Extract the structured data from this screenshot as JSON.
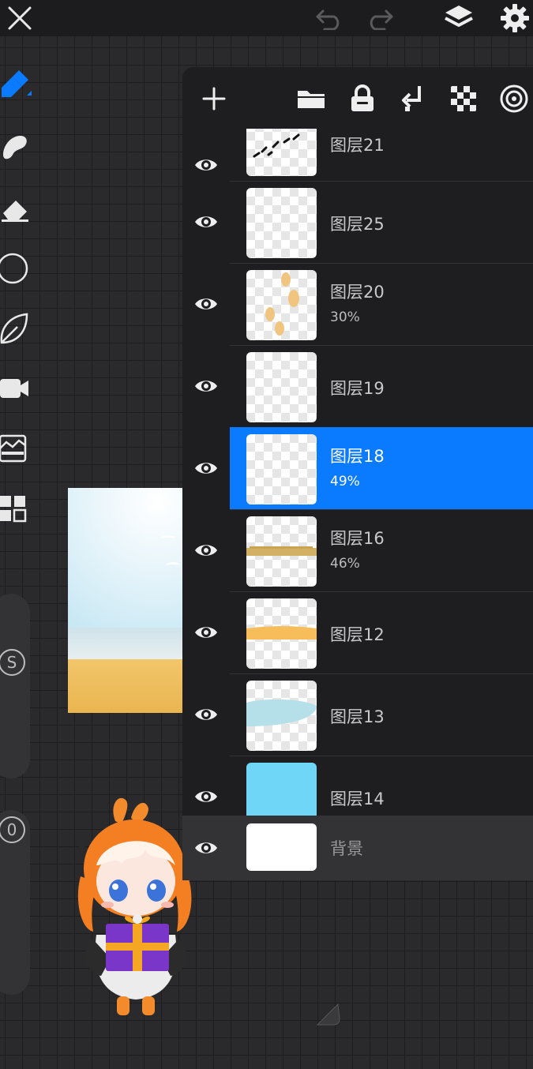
{
  "topbar": {
    "icons": [
      "close-icon",
      "undo-icon",
      "redo-icon",
      "layers-icon",
      "gear-icon"
    ]
  },
  "tools": {
    "icons": [
      "brush-icon",
      "smudge-icon",
      "eraser-icon",
      "select-circle-icon",
      "leaf-icon",
      "video-icon",
      "filter-icon",
      "gallery-grid-icon"
    ],
    "size_slider_label": "S",
    "opacity_slider_label": "0"
  },
  "layer_panel": {
    "toolbar_icons": [
      "add-icon",
      "folder-icon",
      "lock-icon",
      "merge-down-icon",
      "checker-icon",
      "target-icon"
    ],
    "layers": [
      {
        "name": "图层21",
        "opacity": "",
        "selected": false
      },
      {
        "name": "图层25",
        "opacity": "",
        "selected": false
      },
      {
        "name": "图层20",
        "opacity": "30%",
        "selected": false
      },
      {
        "name": "图层19",
        "opacity": "",
        "selected": false
      },
      {
        "name": "图层18",
        "opacity": "49%",
        "selected": true
      },
      {
        "name": "图层16",
        "opacity": "46%",
        "selected": false
      },
      {
        "name": "图层12",
        "opacity": "",
        "selected": false
      },
      {
        "name": "图层13",
        "opacity": "",
        "selected": false
      },
      {
        "name": "图层14",
        "opacity": "",
        "selected": false
      }
    ],
    "background_layer": {
      "name": "背景"
    }
  },
  "colors": {
    "accent": "#0a7bff",
    "panel_bg": "#1e1e20"
  }
}
